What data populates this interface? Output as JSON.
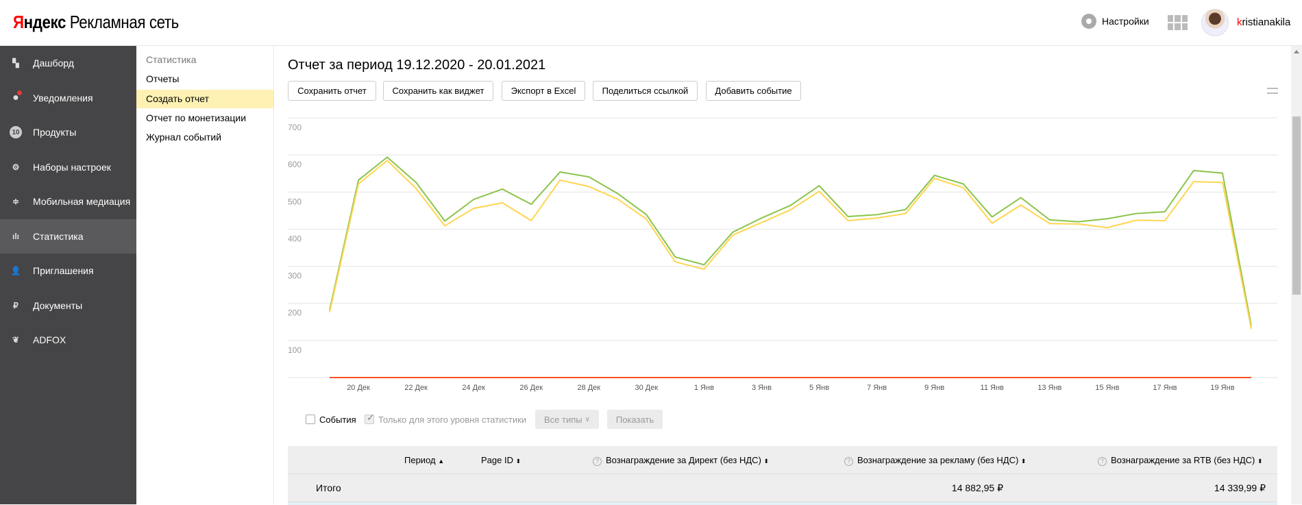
{
  "header": {
    "logo_brand": "Яндекс",
    "logo_brand_first": "Я",
    "logo_brand_rest": "ндекс",
    "logo_product": "Рекламная сеть",
    "settings_label": "Настройки",
    "username_first": "k",
    "username_rest": "ristianakila"
  },
  "sidebar": {
    "items": [
      {
        "label": "Дашборд",
        "icon": "dashboard-icon"
      },
      {
        "label": "Уведомления",
        "icon": "notification-bulb-icon"
      },
      {
        "label": "Продукты",
        "icon": "products-badge-icon",
        "badge": "10"
      },
      {
        "label": "Наборы настроек",
        "icon": "settings-set-icon"
      },
      {
        "label": "Мобильная медиация",
        "icon": "mediation-icon"
      },
      {
        "label": "Статистика",
        "icon": "statistics-icon",
        "active": true
      },
      {
        "label": "Приглашения",
        "icon": "invite-user-icon"
      },
      {
        "label": "Документы",
        "icon": "document-ruble-icon"
      },
      {
        "label": "ADFOX",
        "icon": "adfox-icon"
      }
    ]
  },
  "subnav": {
    "title": "Статистика",
    "items": [
      {
        "label": "Отчеты"
      },
      {
        "label": "Создать отчет",
        "active": true
      },
      {
        "label": "Отчет по монетизации"
      },
      {
        "label": "Журнал событий"
      }
    ]
  },
  "main": {
    "title": "Отчет за период 19.12.2020 - 20.01.2021",
    "buttons": {
      "save": "Сохранить отчет",
      "save_widget": "Сохранить как виджет",
      "export": "Экспорт в Excel",
      "share": "Поделиться ссылкой",
      "add_event": "Добавить событие"
    }
  },
  "controls": {
    "events_label": "События",
    "events_checked": false,
    "level_only_label": "Только для этого уровня статистики",
    "level_only_checked": true,
    "types_select": "Все типы",
    "show_button": "Показать"
  },
  "table": {
    "columns": [
      {
        "label": "Период",
        "sort": "asc"
      },
      {
        "label": "Page ID",
        "sort": "both"
      },
      {
        "label": "Вознаграждение за Директ (без НДС)",
        "sort": "both",
        "help": true
      },
      {
        "label": "Вознаграждение за рекламу (без НДС)",
        "sort": "both",
        "help": true
      },
      {
        "label": "Вознаграждение за RTB (без НДС)",
        "sort": "both",
        "help": true
      }
    ],
    "total_row": {
      "label": "Итого",
      "direct": "",
      "ads": "14 882,95 ₽",
      "rtb": "14 339,99 ₽"
    }
  },
  "chart_data": {
    "type": "line",
    "x": [
      "19 Дек",
      "20 Дек",
      "21 Дек",
      "22 Дек",
      "23 Дек",
      "24 Дек",
      "25 Дек",
      "26 Дек",
      "27 Дек",
      "28 Дек",
      "29 Дек",
      "30 Дек",
      "31 Дек",
      "1 Янв",
      "2 Янв",
      "3 Янв",
      "4 Янв",
      "5 Янв",
      "6 Янв",
      "7 Янв",
      "8 Янв",
      "9 Янв",
      "10 Янв",
      "11 Янв",
      "12 Янв",
      "13 Янв",
      "14 Янв",
      "15 Янв",
      "16 Янв",
      "17 Янв",
      "18 Янв",
      "19 Янв",
      "20 Янв"
    ],
    "x_tick_labels": [
      "20 Дек",
      "22 Дек",
      "24 Дек",
      "26 Дек",
      "28 Дек",
      "30 Дек",
      "1 Янв",
      "3 Янв",
      "5 Янв",
      "7 Янв",
      "9 Янв",
      "11 Янв",
      "13 Янв",
      "15 Янв",
      "17 Янв",
      "19 Янв"
    ],
    "y_tick_labels": [
      "100",
      "200",
      "300",
      "400",
      "500",
      "600",
      "700"
    ],
    "ylim": [
      0,
      700
    ],
    "grid": true,
    "series": [
      {
        "color": "#8bc34a",
        "values": [
          182,
          532,
          594,
          526,
          422,
          480,
          508,
          467,
          554,
          541,
          496,
          439,
          325,
          304,
          392,
          430,
          464,
          517,
          434,
          439,
          453,
          545,
          522,
          433,
          485,
          425,
          420,
          428,
          442,
          447,
          558,
          551,
          139
        ]
      },
      {
        "color": "#ffd54f",
        "values": [
          176,
          522,
          585,
          510,
          409,
          456,
          471,
          423,
          532,
          515,
          481,
          427,
          312,
          292,
          384,
          418,
          452,
          502,
          423,
          430,
          442,
          537,
          512,
          416,
          465,
          415,
          414,
          404,
          424,
          423,
          528,
          526,
          131
        ]
      },
      {
        "color": "#f4511e",
        "values": [
          0,
          0,
          0,
          0,
          0,
          0,
          0,
          0,
          0,
          0,
          0,
          0,
          0,
          0,
          0,
          0,
          0,
          0,
          0,
          0,
          0,
          0,
          0,
          0,
          0,
          0,
          0,
          0,
          0,
          0,
          0,
          0,
          0
        ]
      }
    ]
  }
}
